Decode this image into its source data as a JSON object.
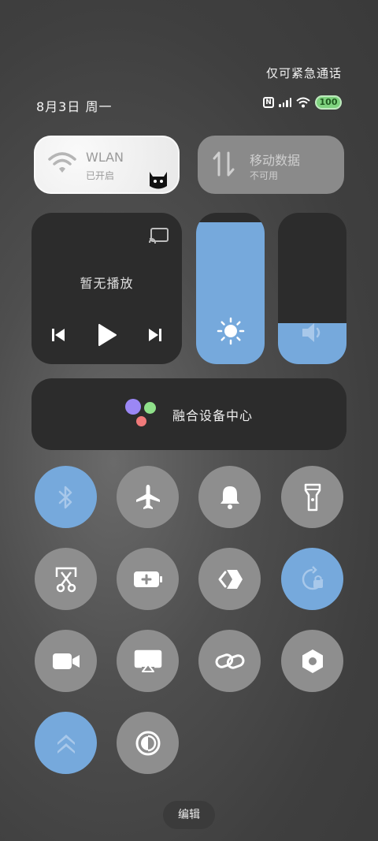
{
  "status": {
    "emergency_text": "仅可紧急通话",
    "date_text": "8月3日 周一",
    "nfc_label": "N",
    "battery_level": "100"
  },
  "tiles": {
    "wlan": {
      "title": "WLAN",
      "subtitle": "已开启",
      "icon": "wifi-icon",
      "state": "on"
    },
    "mobile_data": {
      "title": "移动数据",
      "subtitle": "不可用",
      "icon": "data-arrows-icon",
      "state": "disabled"
    }
  },
  "media": {
    "title": "暂无播放",
    "controls": [
      "previous-icon",
      "play-icon",
      "next-icon"
    ]
  },
  "sliders": {
    "brightness": {
      "icon": "sun-icon",
      "level_percent": 94
    },
    "volume": {
      "icon": "speaker-icon",
      "level_percent": 27
    }
  },
  "fusion": {
    "label": "融合设备中心"
  },
  "toggles": [
    {
      "name": "bluetooth",
      "icon": "bluetooth-icon",
      "on": true
    },
    {
      "name": "airplane",
      "icon": "airplane-icon",
      "on": false
    },
    {
      "name": "ringer",
      "icon": "bell-icon",
      "on": false
    },
    {
      "name": "flashlight",
      "icon": "flashlight-icon",
      "on": false
    },
    {
      "name": "screenshot",
      "icon": "scissors-icon",
      "on": false
    },
    {
      "name": "battery-saver",
      "icon": "battery-plus-icon",
      "on": false
    },
    {
      "name": "share",
      "icon": "share-diamond-icon",
      "on": false
    },
    {
      "name": "rotation-lock",
      "icon": "rotation-lock-icon",
      "on": true
    },
    {
      "name": "screen-record",
      "icon": "video-camera-icon",
      "on": false
    },
    {
      "name": "projection",
      "icon": "screencast-icon",
      "on": false
    },
    {
      "name": "link",
      "icon": "link-icon",
      "on": false
    },
    {
      "name": "settings",
      "icon": "hexagon-settings-icon",
      "on": false
    },
    {
      "name": "performance",
      "icon": "double-chevron-up-icon",
      "on": true
    },
    {
      "name": "dark-mode",
      "icon": "contrast-icon",
      "on": false
    }
  ],
  "footer": {
    "edit_label": "编辑"
  },
  "colors": {
    "accent": "#76a9dc",
    "tile_dark": "#2c2c2c",
    "toggle_off": "#8e8e8e",
    "battery": "#7fd37f"
  }
}
